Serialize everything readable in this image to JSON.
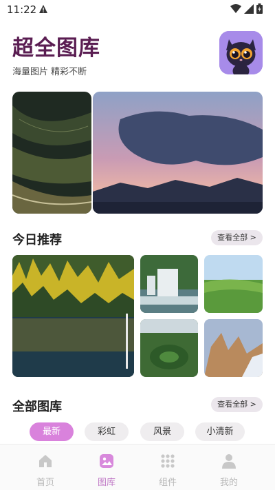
{
  "status_bar": {
    "time": "11:22"
  },
  "header": {
    "title": "超全图库",
    "subtitle": "海量图片 精彩不断"
  },
  "today": {
    "title_prefix": "今日",
    "title_highlight": "推荐",
    "view_all": "查看全部 >"
  },
  "all": {
    "title_prefix": "全部",
    "title_highlight": "图库",
    "view_all": "查看全部 >",
    "tabs": [
      {
        "label": "最新",
        "active": true
      },
      {
        "label": "彩虹",
        "active": false
      },
      {
        "label": "风景",
        "active": false
      },
      {
        "label": "小清新",
        "active": false
      }
    ]
  },
  "bottom_nav": {
    "items": [
      {
        "label": "首页",
        "icon": "home-icon",
        "active": false
      },
      {
        "label": "图库",
        "icon": "gallery-icon",
        "active": true
      },
      {
        "label": "组件",
        "icon": "grid-icon",
        "active": false
      },
      {
        "label": "我的",
        "icon": "person-icon",
        "active": false
      }
    ]
  },
  "colors": {
    "accent": "#c07ac6",
    "title": "#5a1d52",
    "chip_active": "#d982dc"
  }
}
